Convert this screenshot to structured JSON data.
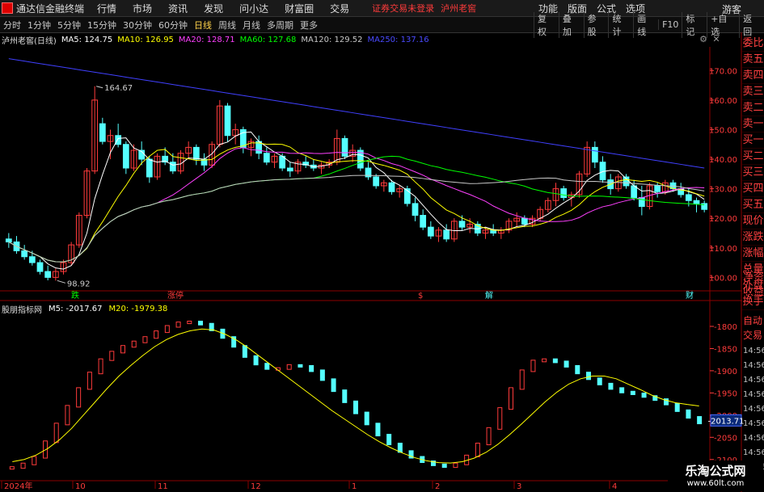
{
  "app": {
    "title": "通达信金融终端",
    "status": "证券交易未登录",
    "stock_name": "泸州老窖",
    "guest": "游客"
  },
  "menu": [
    "行情",
    "市场",
    "资讯",
    "发现",
    "问小达",
    "财富圈",
    "交易"
  ],
  "right_menu": [
    "功能",
    "版面",
    "公式",
    "选项"
  ],
  "periods": [
    "分时",
    "1分钟",
    "5分钟",
    "15分钟",
    "30分钟",
    "60分钟",
    "日线",
    "周线",
    "月线",
    "多周期",
    "更多"
  ],
  "active_period": "日线",
  "right_buttons": [
    "复权",
    "叠加",
    "参股",
    "统计",
    "画线",
    "F10",
    "标记",
    "+自选",
    "返回"
  ],
  "info": {
    "stock": "泸州老窖(日线)",
    "ma5": "MA5: 124.75",
    "ma10": "MA10: 126.95",
    "ma20": "MA20: 128.71",
    "ma60": "MA60: 127.68",
    "ma120": "MA120: 129.52",
    "ma250": "MA250: 137.16"
  },
  "colors": {
    "ma5": "#ffffff",
    "ma10": "#ffff00",
    "ma20": "#ff40ff",
    "ma60": "#00ff00",
    "ma120": "#c8c8c8",
    "ma250": "#4040ff",
    "up": "#ff3b3b",
    "down": "#54ffff"
  },
  "price_axis": [
    "170.00",
    "160.00",
    "150.00",
    "140.00",
    "130.00",
    "120.00",
    "110.00",
    "100.00"
  ],
  "price_labels": {
    "high": "164.67",
    "low": "98.92"
  },
  "markers": [
    {
      "text": "跌"
    },
    {
      "text": "涨停"
    },
    {
      "text": "$"
    },
    {
      "text": "解"
    },
    {
      "text": "财"
    }
  ],
  "side_tabs": [
    "委比",
    "卖五",
    "卖四",
    "卖三",
    "卖二",
    "卖一",
    "买一",
    "买二",
    "买三",
    "买四",
    "买五",
    "现价",
    "涨跌",
    "涨幅",
    "总量",
    "外盘",
    "换手",
    "净资",
    "收益"
  ],
  "side_tabs_lower": [
    "自动",
    "交易",
    "14:56",
    "14:56",
    "14:56",
    "14:56",
    "14:56",
    "14:56",
    "14:56",
    "14:56",
    "14:56"
  ],
  "sub_info": {
    "name": "股朋指标网",
    "m5": "M5: -2017.67",
    "m20": "M20: -1979.38"
  },
  "sub_axis": [
    "-1800",
    "-1850",
    "-1900",
    "-1950",
    "-2000",
    "-2050",
    "-2100"
  ],
  "sub_current": "-2013.71",
  "date_axis": [
    "2024年",
    "10",
    "11",
    "12",
    "1",
    "2",
    "3",
    "4"
  ],
  "watermark": {
    "line1": "乐淘公式网",
    "line2": "www.60lt.com"
  },
  "chart_data": {
    "type": "candlestick",
    "price_series_ylim": [
      96,
      178
    ],
    "ohlc": [
      [
        113,
        115,
        110,
        112
      ],
      [
        112,
        114,
        108,
        109
      ],
      [
        109,
        111,
        106,
        107
      ],
      [
        107,
        109,
        104,
        105
      ],
      [
        105,
        106,
        101,
        102
      ],
      [
        102,
        104,
        99,
        100
      ],
      [
        100,
        103,
        98.92,
        102
      ],
      [
        102,
        106,
        101,
        105
      ],
      [
        105,
        112,
        104,
        111
      ],
      [
        111,
        122,
        110,
        121
      ],
      [
        121,
        137,
        120,
        136
      ],
      [
        136,
        164.67,
        135,
        160
      ],
      [
        152,
        154,
        145,
        146
      ],
      [
        146,
        150,
        140,
        148
      ],
      [
        148,
        152,
        144,
        145
      ],
      [
        145,
        146,
        135,
        137
      ],
      [
        137,
        145,
        136,
        143
      ],
      [
        143,
        146,
        138,
        140
      ],
      [
        140,
        141,
        132,
        134
      ],
      [
        134,
        142,
        133,
        141
      ],
      [
        141,
        144,
        138,
        139
      ],
      [
        139,
        142,
        135,
        136
      ],
      [
        136,
        143,
        135,
        142
      ],
      [
        142,
        146,
        140,
        144
      ],
      [
        144,
        145,
        138,
        140
      ],
      [
        140,
        142,
        136,
        138
      ],
      [
        138,
        146,
        137,
        145
      ],
      [
        145,
        160,
        144,
        158
      ],
      [
        158,
        159,
        146,
        148
      ],
      [
        148,
        152,
        145,
        150
      ],
      [
        150,
        151,
        142,
        144
      ],
      [
        144,
        147,
        141,
        146
      ],
      [
        146,
        148,
        140,
        142
      ],
      [
        142,
        144,
        138,
        139
      ],
      [
        139,
        142,
        137,
        141
      ],
      [
        141,
        142,
        136,
        137
      ],
      [
        137,
        139,
        134,
        136
      ],
      [
        136,
        140,
        135,
        139
      ],
      [
        139,
        141,
        137,
        138
      ],
      [
        138,
        140,
        136,
        137
      ],
      [
        137,
        139,
        135,
        138
      ],
      [
        138,
        140,
        137,
        139
      ],
      [
        139,
        150,
        138,
        147
      ],
      [
        147,
        148,
        140,
        141
      ],
      [
        141,
        145,
        139,
        143
      ],
      [
        143,
        144,
        136,
        137
      ],
      [
        137,
        139,
        133,
        134
      ],
      [
        134,
        135,
        130,
        131
      ],
      [
        131,
        133,
        129,
        132
      ],
      [
        132,
        133,
        128,
        129
      ],
      [
        129,
        131,
        127,
        130
      ],
      [
        130,
        131,
        124,
        125
      ],
      [
        125,
        127,
        119,
        121
      ],
      [
        121,
        123,
        116,
        117
      ],
      [
        117,
        119,
        113,
        114
      ],
      [
        114,
        117,
        112,
        116
      ],
      [
        116,
        118,
        112,
        113
      ],
      [
        113,
        120,
        112,
        119
      ],
      [
        119,
        121,
        116,
        117
      ],
      [
        117,
        120,
        115,
        118
      ],
      [
        118,
        119,
        114,
        115
      ],
      [
        115,
        117,
        113,
        116
      ],
      [
        116,
        118,
        114,
        115
      ],
      [
        115,
        117,
        113,
        116
      ],
      [
        116,
        120,
        115,
        119
      ],
      [
        119,
        122,
        117,
        120
      ],
      [
        120,
        121,
        117,
        118
      ],
      [
        118,
        121,
        117,
        120
      ],
      [
        120,
        124,
        119,
        123
      ],
      [
        123,
        127,
        122,
        126
      ],
      [
        126,
        132,
        124,
        130
      ],
      [
        130,
        131,
        126,
        127
      ],
      [
        127,
        129,
        124,
        128
      ],
      [
        128,
        136,
        127,
        135
      ],
      [
        135,
        146,
        134,
        144
      ],
      [
        144,
        146,
        137,
        139
      ],
      [
        139,
        141,
        132,
        133
      ],
      [
        133,
        135,
        128,
        130
      ],
      [
        130,
        135,
        129,
        134
      ],
      [
        134,
        135,
        130,
        131
      ],
      [
        131,
        133,
        126,
        127
      ],
      [
        127,
        131,
        121,
        124
      ],
      [
        124,
        132,
        123,
        131
      ],
      [
        131,
        132,
        127,
        129
      ],
      [
        129,
        133,
        128,
        132
      ],
      [
        132,
        133,
        129,
        130
      ],
      [
        130,
        132,
        127,
        128
      ],
      [
        128,
        130,
        124,
        126
      ],
      [
        126,
        127,
        122,
        125
      ],
      [
        125,
        126,
        122,
        123
      ]
    ],
    "osc_series_ylim": [
      -2135,
      -1780
    ],
    "m5": [
      -2118,
      -2110,
      -2095,
      -2060,
      -2020,
      -1980,
      -1940,
      -1905,
      -1875,
      -1858,
      -1845,
      -1835,
      -1825,
      -1812,
      -1800,
      -1792,
      -1790,
      -1795,
      -1808,
      -1825,
      -1845,
      -1868,
      -1885,
      -1895,
      -1895,
      -1888,
      -1890,
      -1900,
      -1920,
      -1945,
      -1970,
      -1995,
      -2020,
      -2045,
      -2065,
      -2082,
      -2095,
      -2105,
      -2112,
      -2116,
      -2110,
      -2092,
      -2065,
      -2030,
      -1985,
      -1940,
      -1900,
      -1878,
      -1875,
      -1880,
      -1890,
      -1905,
      -1918,
      -1930,
      -1940,
      -1948,
      -1952,
      -1958,
      -1965,
      -1975,
      -1990,
      -2005,
      -2017.67
    ],
    "m20": [
      -2105,
      -2100,
      -2090,
      -2075,
      -2055,
      -2030,
      -2000,
      -1970,
      -1940,
      -1912,
      -1888,
      -1866,
      -1846,
      -1830,
      -1818,
      -1810,
      -1806,
      -1808,
      -1818,
      -1832,
      -1850,
      -1870,
      -1890,
      -1910,
      -1930,
      -1950,
      -1970,
      -1990,
      -2008,
      -2026,
      -2044,
      -2060,
      -2074,
      -2086,
      -2096,
      -2103,
      -2107,
      -2108,
      -2105,
      -2097,
      -2084,
      -2066,
      -2044,
      -2020,
      -1995,
      -1970,
      -1948,
      -1930,
      -1918,
      -1912,
      -1912,
      -1918,
      -1930,
      -1942,
      -1955,
      -1965,
      -1972,
      -1976,
      -1979.38
    ]
  }
}
